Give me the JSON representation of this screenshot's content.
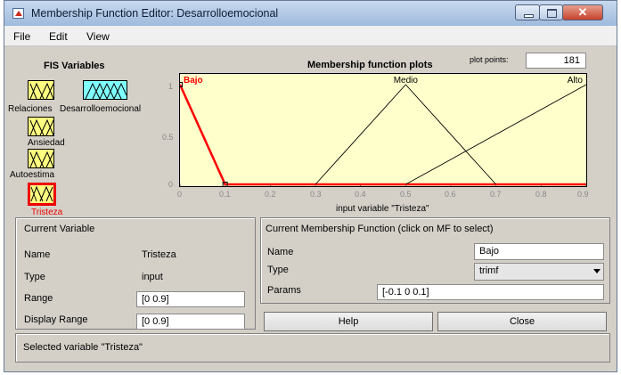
{
  "window": {
    "title": "Membership Function Editor: Desarrolloemocional"
  },
  "menu": [
    "File",
    "Edit",
    "View"
  ],
  "fis_variables": {
    "title": "FIS Variables",
    "overlapping_labels": [
      "Relaciones",
      "Desarrolloemocional"
    ],
    "items": [
      {
        "name": "Relaciones",
        "kind": "input"
      },
      {
        "name": "Desarrolloemocional",
        "kind": "output"
      },
      {
        "name": "Ansiedad",
        "kind": "input"
      },
      {
        "name": "Autoestima",
        "kind": "input"
      },
      {
        "name": "Tristeza",
        "kind": "input",
        "selected": true
      }
    ]
  },
  "plot": {
    "title": "Membership function plots",
    "plot_points_label": "plot points:",
    "plot_points_value": "181",
    "xlabel": "input variable \"Tristeza\""
  },
  "chart_data": {
    "type": "line",
    "title": "Membership function plots",
    "xlabel": "input variable \"Tristeza\"",
    "ylabel": "",
    "xlim": [
      0,
      0.9
    ],
    "ylim": [
      0,
      1
    ],
    "x_ticks": [
      "0",
      "0.1",
      "0.2",
      "0.3",
      "0.4",
      "0.5",
      "0.6",
      "0.7",
      "0.8",
      "0.9"
    ],
    "y_ticks": [
      "0",
      "0.5",
      "1"
    ],
    "series": [
      {
        "name": "Bajo",
        "points": [
          [
            0,
            1
          ],
          [
            0.1,
            0
          ]
        ],
        "selected": true
      },
      {
        "name": "Medio",
        "points": [
          [
            0.3,
            0
          ],
          [
            0.5,
            1
          ],
          [
            0.7,
            0
          ]
        ]
      },
      {
        "name": "Alto",
        "points": [
          [
            0.5,
            0
          ],
          [
            0.9,
            1
          ]
        ]
      }
    ],
    "selected_color": "#ff0000",
    "line_color": "#000000",
    "background": "#ffffcc"
  },
  "current_variable": {
    "heading": "Current Variable",
    "name_label": "Name",
    "name_value": "Tristeza",
    "type_label": "Type",
    "type_value": "input",
    "range_label": "Range",
    "range_value": "[0 0.9]",
    "display_range_label": "Display Range",
    "display_range_value": "[0 0.9]"
  },
  "current_mf": {
    "heading": "Current Membership Function (click on MF to select)",
    "name_label": "Name",
    "name_value": "Bajo",
    "type_label": "Type",
    "type_value": "trimf",
    "params_label": "Params",
    "params_value": "[-0.1 0 0.1]"
  },
  "buttons": {
    "help": "Help",
    "close": "Close"
  },
  "status": "Selected variable \"Tristeza\""
}
